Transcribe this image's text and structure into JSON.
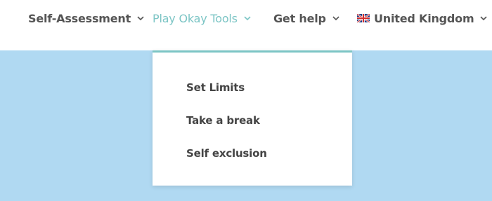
{
  "nav": {
    "items": [
      {
        "label": "Self-Assessment",
        "icon": "chevron-down-icon"
      },
      {
        "label": "Play Okay Tools",
        "icon": "chevron-down-icon"
      },
      {
        "label": "Get help",
        "icon": "chevron-down-icon"
      },
      {
        "label": "United Kingdom",
        "icon": "uk-flag-icon"
      }
    ]
  },
  "dropdown": {
    "items": [
      {
        "label": "Set Limits"
      },
      {
        "label": "Take a break"
      },
      {
        "label": "Self exclusion"
      }
    ]
  },
  "colors": {
    "accent": "#7cc5c5",
    "background": "#b0d9f2",
    "nav_text": "#555555"
  }
}
